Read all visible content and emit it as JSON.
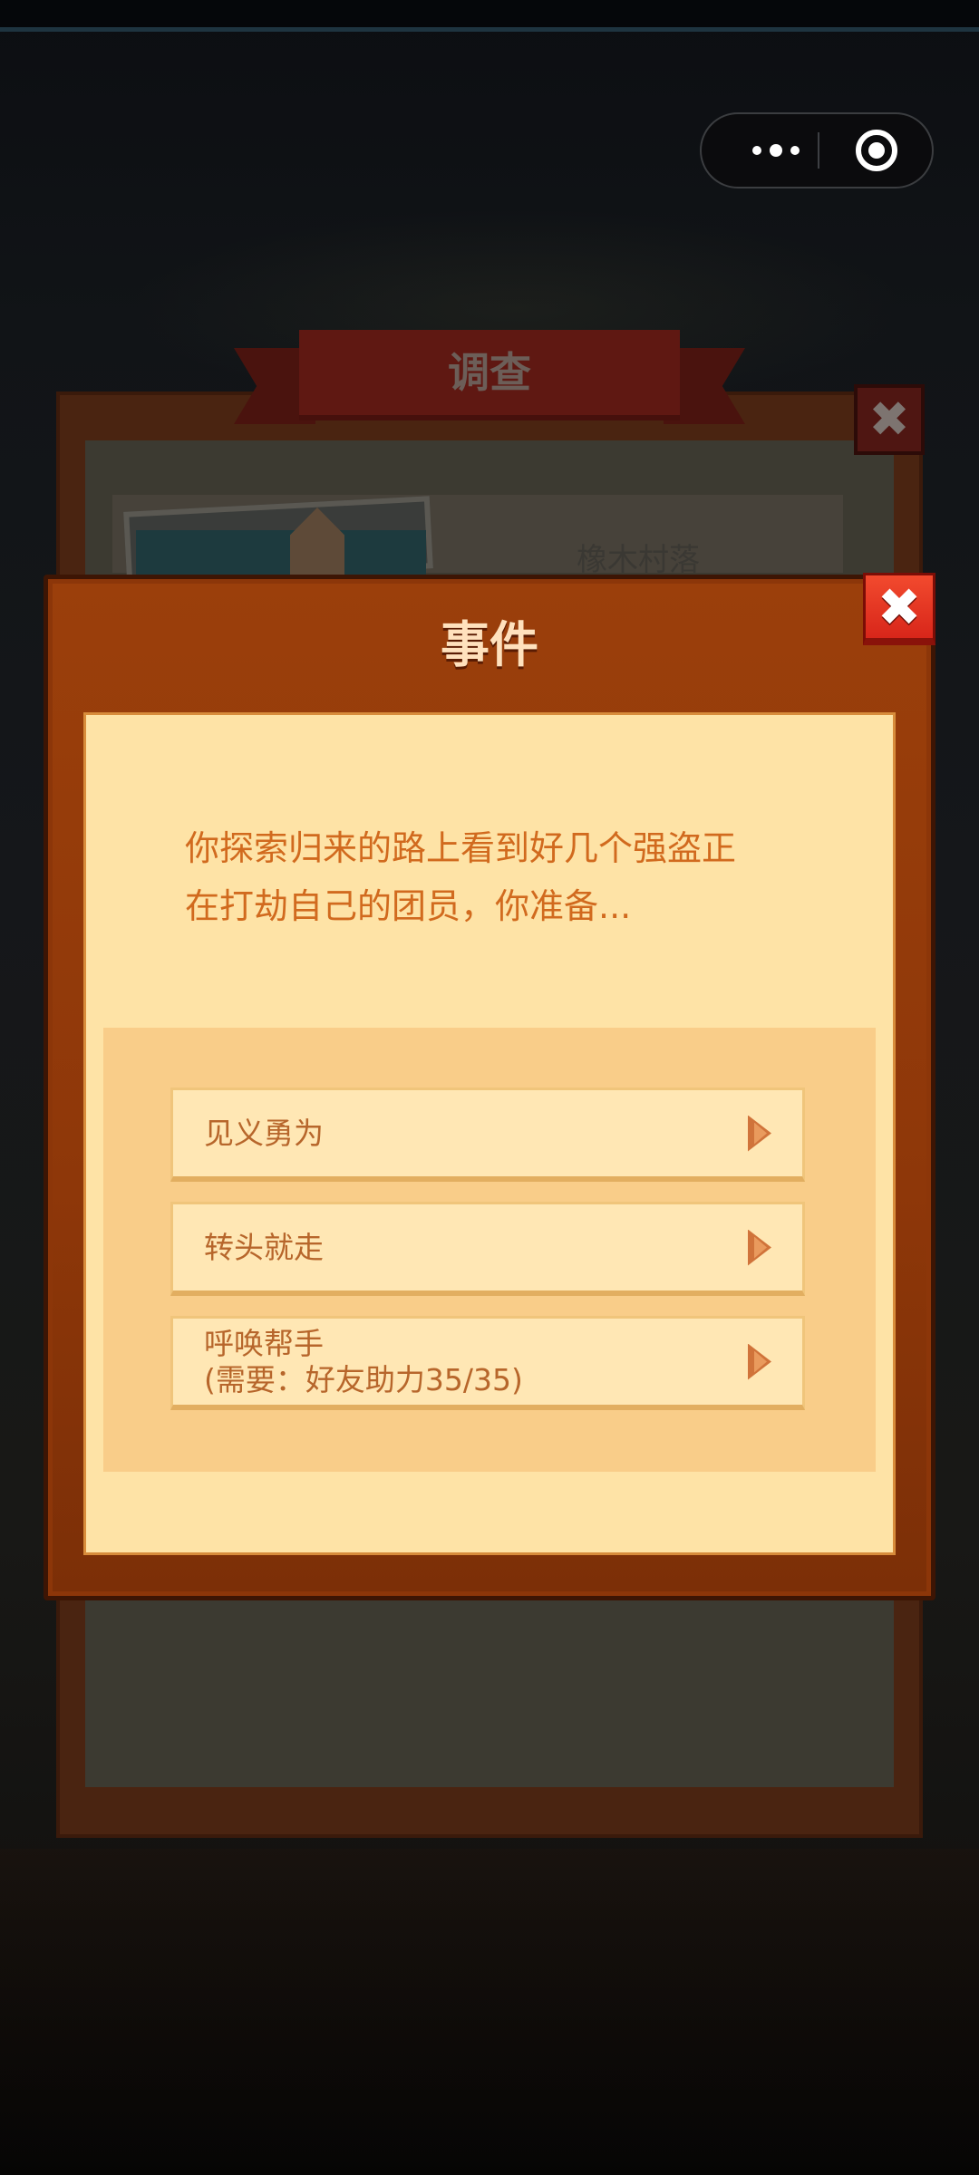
{
  "capsule": {
    "more_icon": "more-dots-icon",
    "close_icon": "target-circle-icon"
  },
  "background_panel": {
    "title": "调查",
    "close_symbol": "✖",
    "village_name": "橡木村落"
  },
  "dialog": {
    "title": "事件",
    "close_symbol": "✖",
    "message": "你探索归来的路上看到好几个强盗正\n在打劫自己的团员，你准备...",
    "options": [
      {
        "label": "见义勇为",
        "sub": ""
      },
      {
        "label": "转头就走",
        "sub": ""
      },
      {
        "label": "呼唤帮手",
        "sub": "(需要：好友助力35/35)"
      }
    ]
  },
  "colors": {
    "dialog_frame": "#8c3609",
    "content_bg": "#fee3a6",
    "option_bg": "#ffe7b4",
    "text_orange": "#d16a1e",
    "close_red": "#e0301f"
  }
}
